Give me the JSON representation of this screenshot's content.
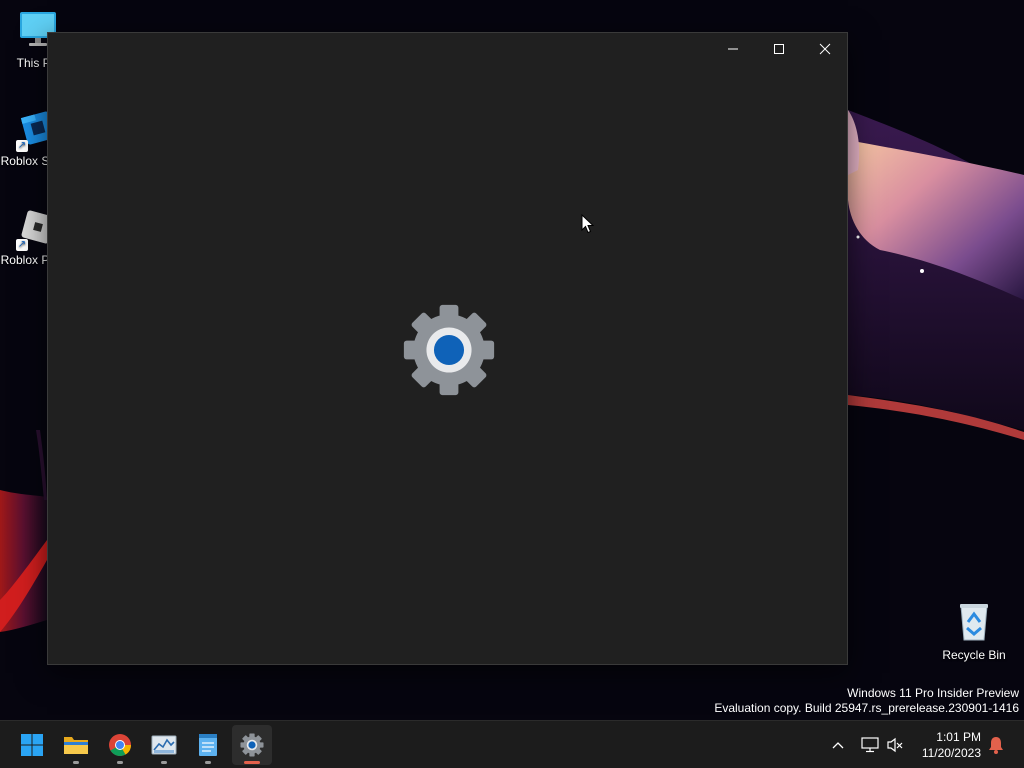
{
  "desktop": {
    "icons": [
      {
        "label": "This PC",
        "icon": "monitor-icon"
      },
      {
        "label": "Roblox Studio",
        "icon": "roblox-studio-icon"
      },
      {
        "label": "Roblox Player",
        "icon": "roblox-player-icon"
      },
      {
        "label": "Recycle Bin",
        "icon": "recycle-bin-icon"
      }
    ],
    "watermark": {
      "line1": "Windows 11 Pro Insider Preview",
      "line2": "Evaluation copy. Build 25947.rs_prerelease.230901-1416"
    }
  },
  "window": {
    "app": "Settings",
    "splash_icon": "settings-gear-icon",
    "controls": [
      "minimize-icon",
      "maximize-icon",
      "close-icon"
    ]
  },
  "taskbar": {
    "apps": [
      {
        "name": "Start",
        "icon": "windows-logo-icon"
      },
      {
        "name": "File Explorer",
        "icon": "folder-icon",
        "running": true
      },
      {
        "name": "Google Chrome",
        "icon": "chrome-icon",
        "running": true
      },
      {
        "name": "Task Manager",
        "icon": "task-manager-icon",
        "running": true
      },
      {
        "name": "Notepad",
        "icon": "notepad-icon",
        "running": true
      },
      {
        "name": "Settings",
        "icon": "settings-gear-icon",
        "running": true,
        "active": true
      }
    ],
    "tray": [
      "chevron-up-icon",
      "network-icon",
      "volume-muted-icon",
      "notification-bell-icon"
    ],
    "clock": {
      "time": "1:01 PM",
      "date": "11/20/2023"
    }
  },
  "colors": {
    "window_bg": "#202020",
    "taskbar_bg": "#1c1c1c",
    "accent_blue": "#0f62b8",
    "active_indicator": "#e2614c"
  }
}
